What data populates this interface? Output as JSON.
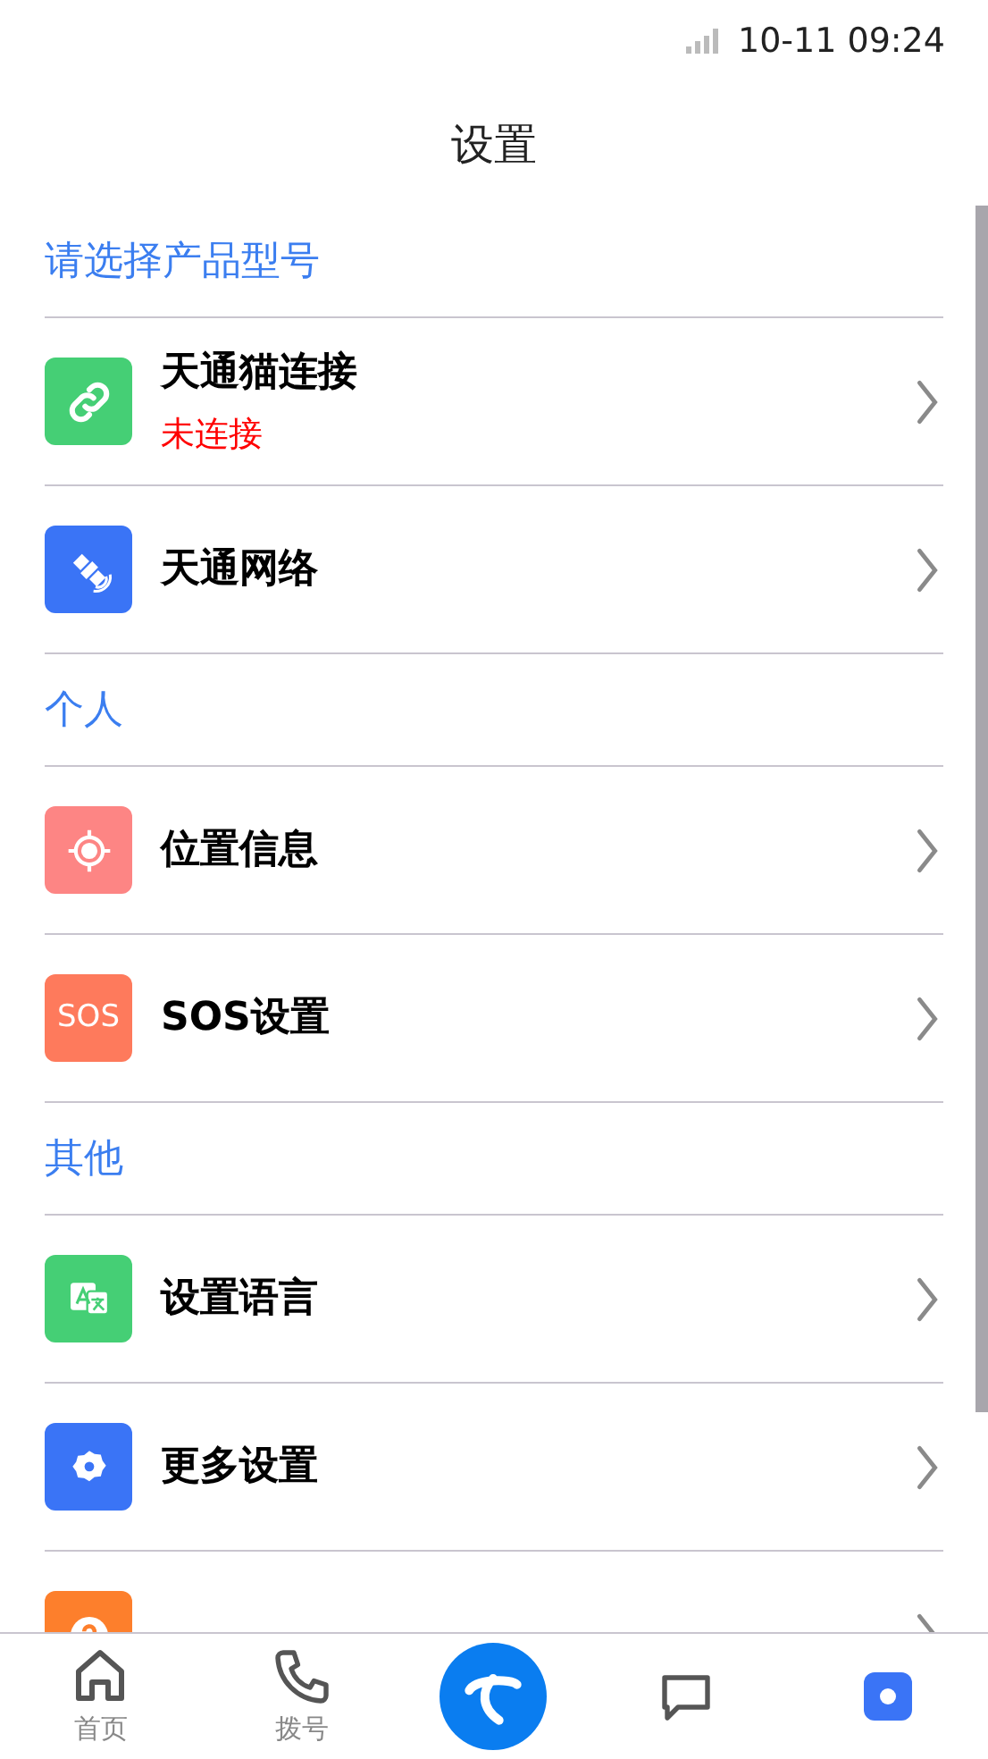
{
  "status_bar": {
    "time": "10-11 09:24"
  },
  "header": {
    "title": "设置"
  },
  "sections": [
    {
      "title": "请选择产品型号",
      "items": [
        {
          "kind": "link",
          "label": "天通猫连接",
          "status": "未连接"
        },
        {
          "kind": "satellite",
          "label": "天通网络"
        }
      ]
    },
    {
      "title": "个人",
      "items": [
        {
          "kind": "target",
          "label": "位置信息"
        },
        {
          "kind": "sos",
          "label": "SOS设置",
          "icon_text": "SOS"
        }
      ]
    },
    {
      "title": "其他",
      "items": [
        {
          "kind": "translate",
          "label": "设置语言"
        },
        {
          "kind": "gear",
          "label": "更多设置"
        },
        {
          "kind": "question"
        }
      ]
    }
  ],
  "bottom_nav": [
    {
      "kind": "home",
      "label": "首页",
      "selected": false
    },
    {
      "kind": "phone",
      "label": "拨号",
      "selected": false
    },
    {
      "kind": "logo"
    },
    {
      "kind": "chat",
      "selected": false
    },
    {
      "kind": "settings",
      "selected": true
    }
  ]
}
